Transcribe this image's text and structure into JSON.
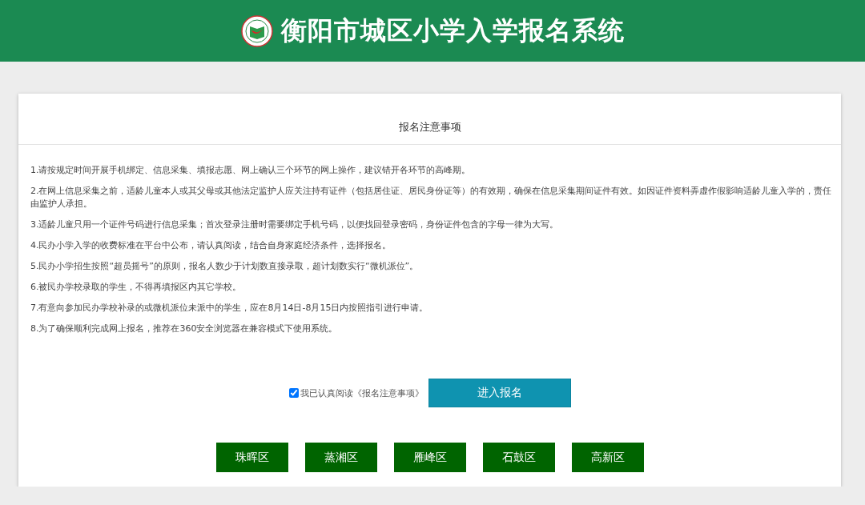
{
  "header": {
    "title": "衡阳市城区小学入学报名系统"
  },
  "notice": {
    "title": "报名注意事项",
    "items": [
      "1.请按规定时间开展手机绑定、信息采集、填报志愿、网上确认三个环节的网上操作，建议错开各环节的高峰期。",
      "2.在网上信息采集之前，适龄儿童本人或其父母或其他法定监护人应关注持有证件（包括居住证、居民身份证等）的有效期，确保在信息采集期间证件有效。如因证件资料弄虚作假影响适龄儿童入学的，责任由监护人承担。",
      "3.适龄儿童只用一个证件号码进行信息采集；首次登录注册时需要绑定手机号码，以便找回登录密码，身份证件包含的字母一律为大写。",
      "4.民办小学入学的收费标准在平台中公布，请认真阅读，结合自身家庭经济条件，选择报名。",
      "5.民办小学招生按照“超员摇号”的原则，报名人数少于计划数直接录取，超计划数实行“微机派位”。",
      "6.被民办学校录取的学生，不得再填报区内其它学校。",
      "7.有意向参加民办学校补录的或微机派位未派中的学生，应在8月14日-8月15日内按照指引进行申请。",
      "8.为了确保顺利完成网上报名，推荐在360安全浏览器在兼容模式下使用系统。"
    ]
  },
  "agreement": {
    "label": "我已认真阅读《报名注意事项》",
    "checked": true
  },
  "enter_button": "进入报名",
  "districts": [
    "珠晖区",
    "蒸湘区",
    "雁峰区",
    "石鼓区",
    "高新区"
  ]
}
